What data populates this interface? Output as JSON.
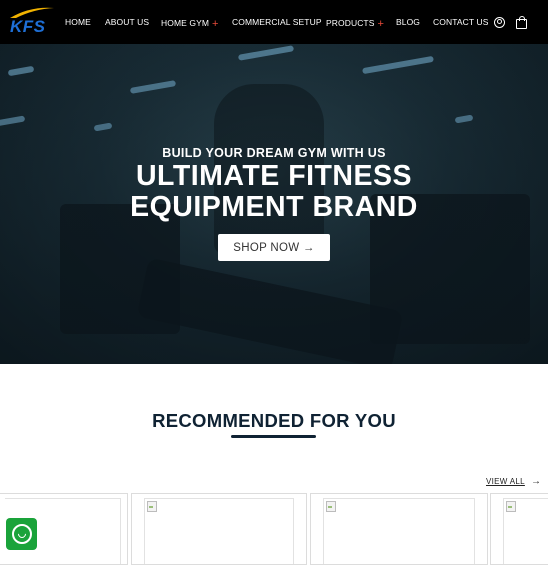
{
  "brand": {
    "logo_text": "KFS"
  },
  "nav": {
    "items": [
      {
        "label": "HOME"
      },
      {
        "label": "ABOUT US"
      },
      {
        "label": "HOME GYM",
        "has_plus": true
      },
      {
        "label": "COMMERCIAL SETUP"
      },
      {
        "label": "PRODUCTS",
        "has_plus": true
      },
      {
        "label": "BLOG"
      },
      {
        "label": "CONTACT US"
      }
    ],
    "plus_symbol": "+",
    "icons": [
      "user-icon",
      "shopping-bag-icon"
    ]
  },
  "hero": {
    "subtitle": "BUILD YOUR DREAM GYM WITH US",
    "title_line1": "ULTIMATE FITNESS",
    "title_line2": "EQUIPMENT BRAND",
    "button_label": "SHOP NOW →"
  },
  "recommended": {
    "title": "RECOMMENDED FOR YOU",
    "view_all_label": "VIEW ALL",
    "view_all_arrow": "→"
  },
  "colors": {
    "nav_bg": "#000000",
    "accent_plus": "#e84b3a",
    "logo_blue": "#1e6fd6",
    "heading": "#0f2233",
    "whatsapp": "#1aa33a"
  },
  "floating": {
    "icon": "whatsapp-icon"
  }
}
